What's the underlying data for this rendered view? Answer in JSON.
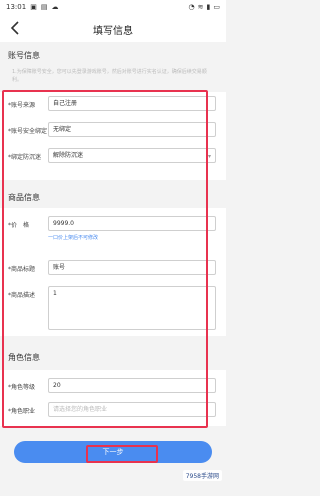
{
  "status_bar": {
    "time": "13:01",
    "icons_left": [
      "image-icon",
      "hd-icon",
      "cloud-icon"
    ],
    "icons_right": [
      "bell-icon",
      "wifi-icon",
      "signal-icon",
      "battery-icon"
    ]
  },
  "header": {
    "title": "填写信息",
    "back_icon": "back-arrow-icon"
  },
  "account_section": {
    "title": "账号信息",
    "hint": "1.为保障账号安全，您可以先登录游戏账号，然后对账号进行实名认证，确保后续交易顺利。",
    "fields": [
      {
        "label": "*账号来源",
        "value": "自己注册"
      },
      {
        "label": "*账号安全绑定",
        "value": "无绑定"
      },
      {
        "label": "*绑定防沉迷",
        "value": "解除防沉迷"
      }
    ]
  },
  "product_section": {
    "title": "商品信息",
    "price_label": "*价　格",
    "price_value": "9999.0",
    "price_hint": "一口价上架后不可修改",
    "product_title_label": "*商品标题",
    "product_title_value": "账号",
    "product_desc_label": "*商品描述",
    "product_desc_value": "1"
  },
  "role_section": {
    "title": "角色信息",
    "fields": [
      {
        "label": "*角色等级",
        "value": "20"
      },
      {
        "label": "*角色职业",
        "value": "请选择您的角色职业"
      }
    ]
  },
  "footer": {
    "next_label": "下一步"
  },
  "watermark": "7958手游网"
}
